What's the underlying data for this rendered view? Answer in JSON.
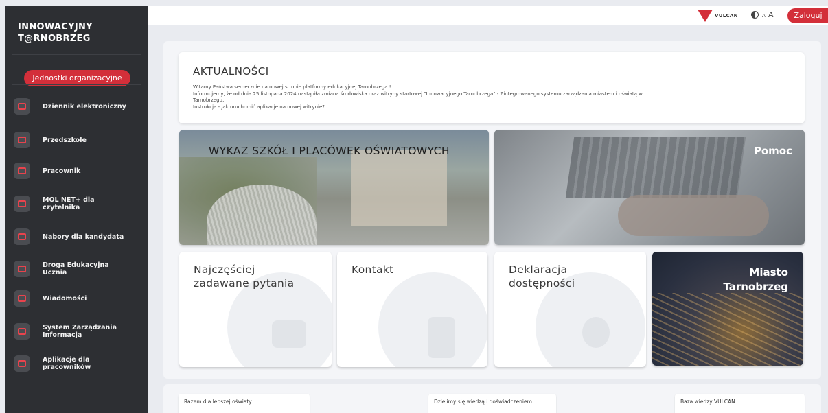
{
  "sidebar": {
    "brand": [
      "INNOWACYJNY",
      "T@RNOBRZEG"
    ],
    "units_button": "Jednostki organizacyjne",
    "items": [
      {
        "label": [
          "Dziennik elektroniczny"
        ],
        "icon": "journal-icon"
      },
      {
        "label": [
          "Przedszkole"
        ],
        "icon": "slide-icon"
      },
      {
        "label": [
          "Pracownik"
        ],
        "icon": "briefcase-icon"
      },
      {
        "label": [
          "MOL NET+ dla",
          "czytelnika"
        ],
        "icon": "books-icon"
      },
      {
        "label": [
          "Nabory dla kandydata"
        ],
        "icon": "trophy-icon"
      },
      {
        "label": [
          "Droga Edukacyjna",
          "Ucznia"
        ],
        "icon": "path-icon"
      },
      {
        "label": [
          "Wiadomości"
        ],
        "icon": "megaphone-icon"
      },
      {
        "label": [
          "System Zarządzania",
          "Informacją"
        ],
        "icon": "building-icon"
      },
      {
        "label": [
          "Aplikacje dla",
          "pracowników"
        ],
        "icon": "grid-icon"
      }
    ]
  },
  "topbar": {
    "vulcan_label": "VULCAN",
    "font_small": "A",
    "font_big": "A",
    "login_label": "Zaloguj"
  },
  "news": {
    "title": "AKTUALNOŚCI",
    "lines": [
      "Witamy Państwa serdecznie na nowej stronie platformy edukacyjnej Tarnobrzega !",
      "Informujemy, że od dnia 25 listopada 2024 nastąpiła zmiana środowiska oraz witryny startowej \"Innowacyjnego Tarnobrzega\" - Zintegrowanego systemu zarządzania miastem i oświatą w",
      "Tarnobrzegu.",
      "Instrukcja - Jak uruchomić aplikacje na nowej witrynie?"
    ]
  },
  "tiles": {
    "schools": "WYKAZ SZKÓŁ I PLACÓWEK OŚWIATOWYCH",
    "help": "Pomoc",
    "faq": [
      "Najczęściej",
      "zadawane pytania"
    ],
    "contact": [
      "Kontakt"
    ],
    "declaration": [
      "Deklaracja",
      "dostępności"
    ],
    "city": [
      "Miasto",
      "Tarnobrzeg"
    ]
  },
  "bottom_cards": [
    "Razem dla lepszej oświaty",
    "Dzielimy się wiedzą i doświadczeniem",
    "Baza wiedzy VULCAN"
  ],
  "colors": {
    "sidebar_bg": "#2d2f33",
    "accent_red": "#d32f3a",
    "page_bg": "#e9ebf0"
  }
}
